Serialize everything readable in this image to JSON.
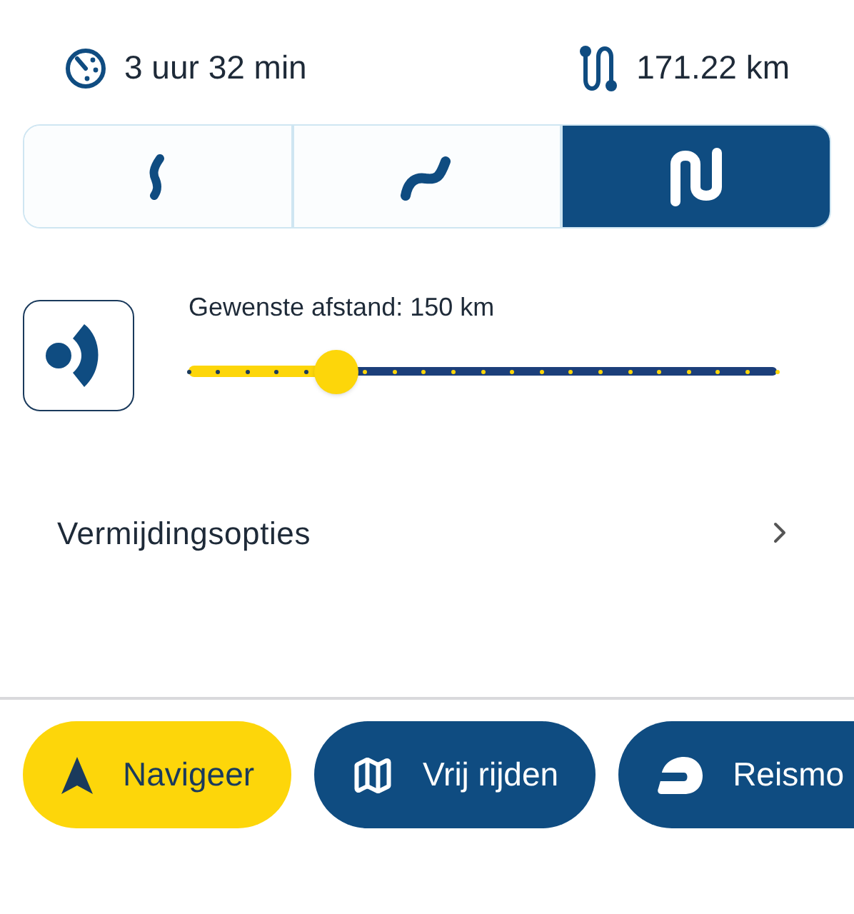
{
  "summary": {
    "duration": "3 uur 32 min",
    "distance": "171.22 km"
  },
  "route_types": [
    {
      "kind": "straight",
      "selected": false
    },
    {
      "kind": "curvy",
      "selected": false
    },
    {
      "kind": "very_curvy",
      "selected": true
    }
  ],
  "distance_setting": {
    "label": "Gewenste afstand: 150 km",
    "level": 0.25
  },
  "avoid_options": {
    "label": "Vermijdingsopties"
  },
  "actions": [
    {
      "kind": "navigate",
      "label": "Navigeer"
    },
    {
      "kind": "free_ride",
      "label": "Vrij rijden"
    },
    {
      "kind": "travel_mode",
      "label": "Reismo"
    }
  ]
}
